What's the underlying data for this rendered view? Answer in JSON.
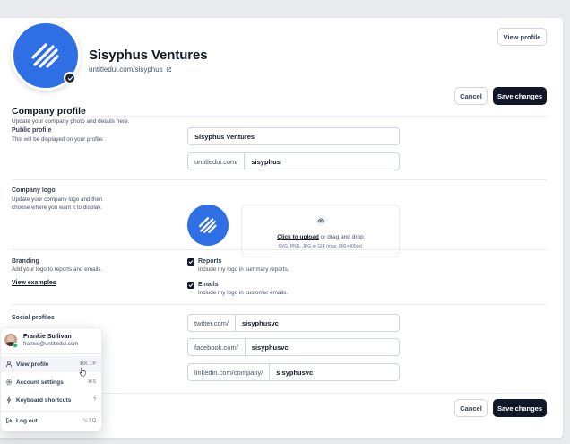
{
  "header": {
    "company_name": "Sisyphus Ventures",
    "company_url": "untitledui.com/sisyphus",
    "view_profile_label": "View profile"
  },
  "section": {
    "title": "Company profile",
    "subtitle": "Update your company photo and details here.",
    "cancel_label": "Cancel",
    "save_label": "Save changes"
  },
  "public_profile": {
    "label": "Public profile",
    "description": "This will be displayed on your profile.",
    "name_value": "Sisyphus Ventures",
    "url_prefix": "untitledui.com/",
    "url_value": "sisyphus"
  },
  "company_logo": {
    "label": "Company logo",
    "description_line1": "Update your company logo and then",
    "description_line2": "choose where you want it to display.",
    "upload_link": "Click to upload",
    "upload_text": " or drag and drop",
    "upload_hint": "SVG, PNG, JPG or GIF (max. 800×400px)"
  },
  "branding": {
    "label": "Branding",
    "description": "Add your logo to reports and emails.",
    "link": "View examples",
    "options": [
      {
        "label": "Reports",
        "description": "Include my logo in summary reports.",
        "checked": true
      },
      {
        "label": "Emails",
        "description": "Include my logo in customer emails.",
        "checked": true
      }
    ]
  },
  "social": {
    "label": "Social profiles",
    "profiles": [
      {
        "prefix": "twitter.com/",
        "value": "sisyphusvc"
      },
      {
        "prefix": "facebook.com/",
        "value": "sisyphusvc"
      },
      {
        "prefix": "linkedin.com/company/",
        "value": "sisyphusvc"
      }
    ]
  },
  "footer": {
    "cancel_label": "Cancel",
    "save_label": "Save changes"
  },
  "user_menu": {
    "name": "Frankie Sullivan",
    "email": "frankie@untitledui.com",
    "items": [
      {
        "label": "View profile",
        "shortcut": "⌘K→P",
        "icon": "user-icon"
      },
      {
        "label": "Account settings",
        "shortcut": "⌘S",
        "icon": "gear-icon"
      },
      {
        "label": "Keyboard shortcuts",
        "shortcut": "?",
        "icon": "lightning-icon"
      },
      {
        "label": "Log out",
        "shortcut": "⌥⇧Q",
        "icon": "logout-icon"
      }
    ]
  },
  "colors": {
    "brand_blue": "#2f6fe6",
    "primary_dark": "#101828"
  }
}
